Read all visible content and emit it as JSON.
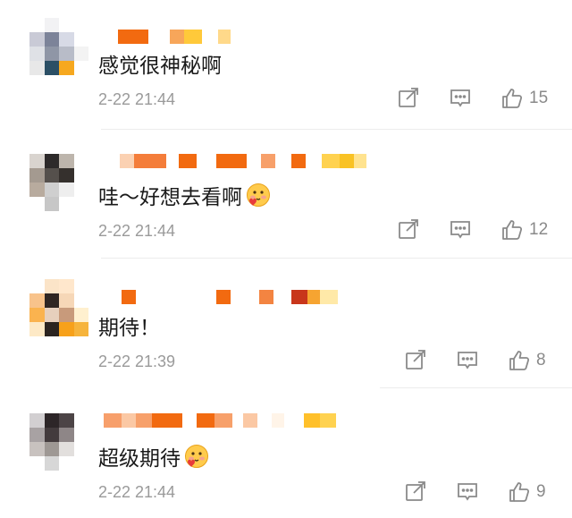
{
  "comments": [
    {
      "text": "感觉很神秘啊",
      "has_emoji": false,
      "time": "2-22 21:44",
      "likes": "15"
    },
    {
      "text": "哇～好想去看啊",
      "has_emoji": true,
      "emoji": "blushing-face-with-heart-emoji",
      "time": "2-22 21:44",
      "likes": "12"
    },
    {
      "text": "期待！",
      "has_emoji": false,
      "time": "2-22 21:39",
      "likes": "8"
    },
    {
      "text": "超级期待",
      "has_emoji": true,
      "emoji": "blushing-face-with-heart-emoji",
      "time": "2-22 21:44",
      "likes": "9"
    }
  ],
  "icons": {
    "share": "share-icon",
    "reply": "comment-icon",
    "like": "thumbs-up-icon"
  },
  "colors": {
    "text": "#1a1a1a",
    "meta": "#9a9a9a",
    "icon": "#8a8a8a",
    "divider": "#ececec",
    "mosaic_orange": "#f26a10"
  }
}
